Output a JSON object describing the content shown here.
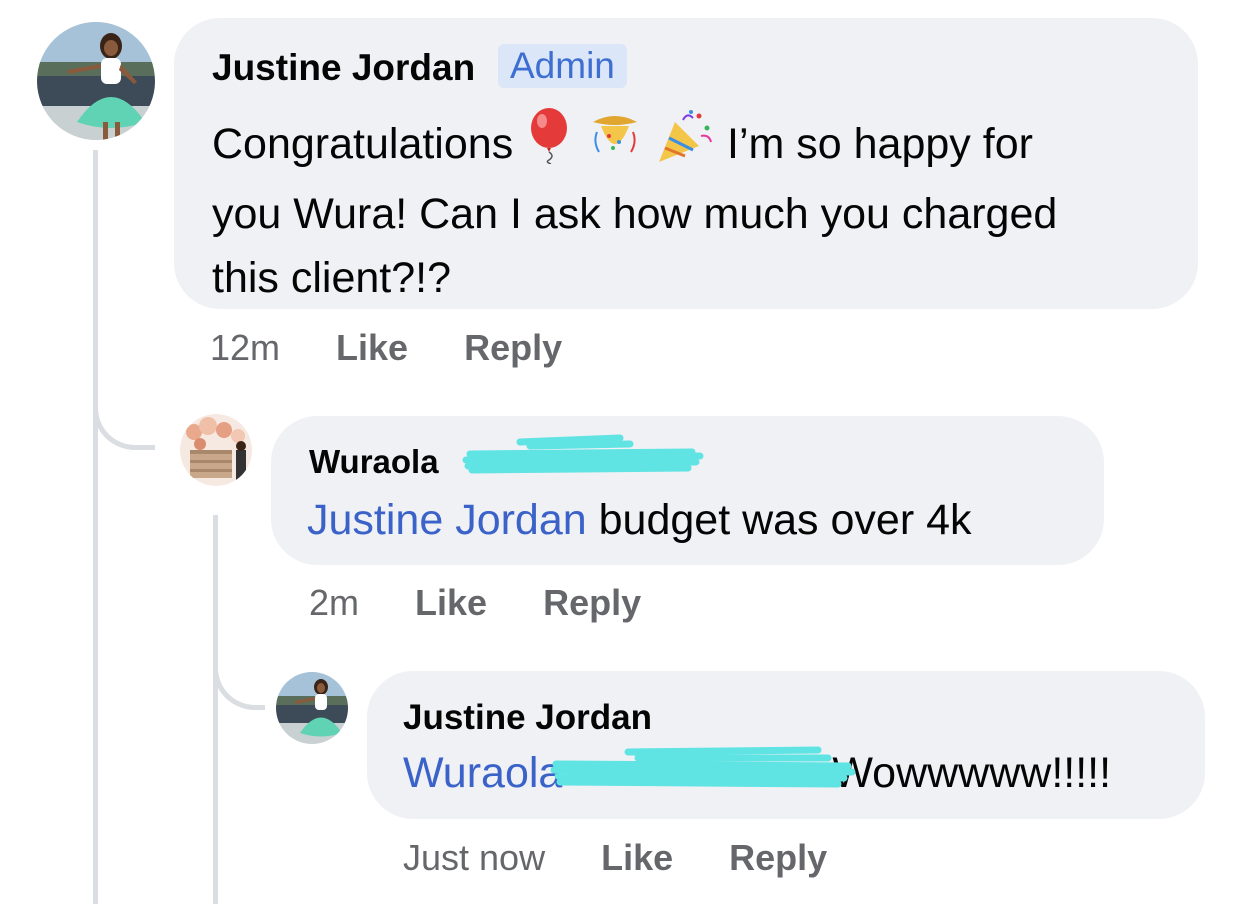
{
  "comments": [
    {
      "author": "Justine Jordan",
      "badge": "Admin",
      "text_before": "Congratulations",
      "emojis": [
        "balloon-emoji",
        "confetti-ball-emoji",
        "party-popper-emoji"
      ],
      "text_line1": "I’m so happy for",
      "text_line2": "you Wura! Can I ask how much you charged",
      "text_line3": "this client?!?",
      "time": "12m",
      "like_label": "Like",
      "reply_label": "Reply"
    },
    {
      "author": "Wuraola",
      "mention": "Justine Jordan",
      "text": " budget was over 4k",
      "time": "2m",
      "like_label": "Like",
      "reply_label": "Reply"
    },
    {
      "author": "Justine Jordan",
      "mention": "Wuraola",
      "text": "Wowwwww!!!!!",
      "time": "Just now",
      "like_label": "Like",
      "reply_label": "Reply"
    }
  ],
  "colors": {
    "bubble": "#f0f1f5",
    "mention": "#3a62c8",
    "meta": "#65676b",
    "admin_badge_bg": "#dbe7f8",
    "redaction": "#5fe3e3"
  }
}
